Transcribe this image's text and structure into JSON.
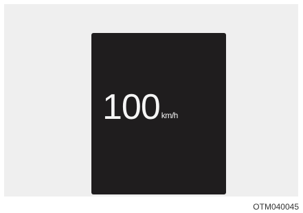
{
  "display": {
    "speed_value": "100",
    "speed_unit": "km/h"
  },
  "figure": {
    "code": "OTM040045"
  },
  "colors": {
    "panel_background": "#1f1d1e",
    "frame_background": "#efefef",
    "readout_text": "#f5f5f5"
  }
}
